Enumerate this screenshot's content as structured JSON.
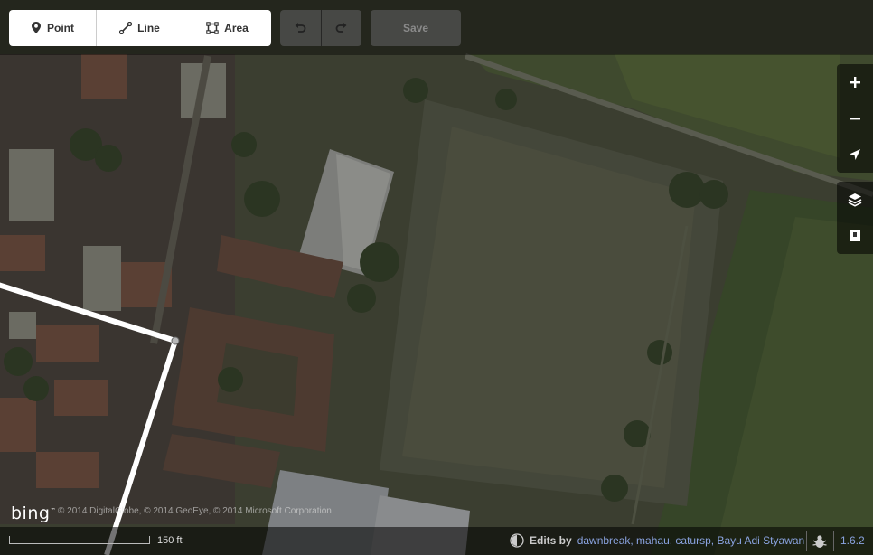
{
  "toolbar": {
    "modes": [
      {
        "label": "Point",
        "icon": "map-pin-icon"
      },
      {
        "label": "Line",
        "icon": "line-icon"
      },
      {
        "label": "Area",
        "icon": "area-icon"
      }
    ],
    "undo_icon": "undo-icon",
    "redo_icon": "redo-icon",
    "save_label": "Save"
  },
  "map_controls": {
    "zoom_in_icon": "plus-icon",
    "zoom_out_icon": "minus-icon",
    "geolocate_icon": "location-arrow-icon",
    "background_icon": "layers-icon",
    "map_data_icon": "map-data-icon"
  },
  "attribution": {
    "logo": "bing",
    "text": "© 2014 DigitalGlobe, © 2014 GeoEye, © 2014 Microsoft Corporation"
  },
  "footer": {
    "scale_label": "150 ft",
    "edits_label": "Edits by",
    "editors": "dawnbreak, mahau, catursp, Bayu Adi Styawan",
    "version": "1.6.2"
  },
  "colors": {
    "accent_link": "#8aa3e0",
    "toolbar_bg": "#ffffff",
    "drawn_line": "#ffffff"
  }
}
